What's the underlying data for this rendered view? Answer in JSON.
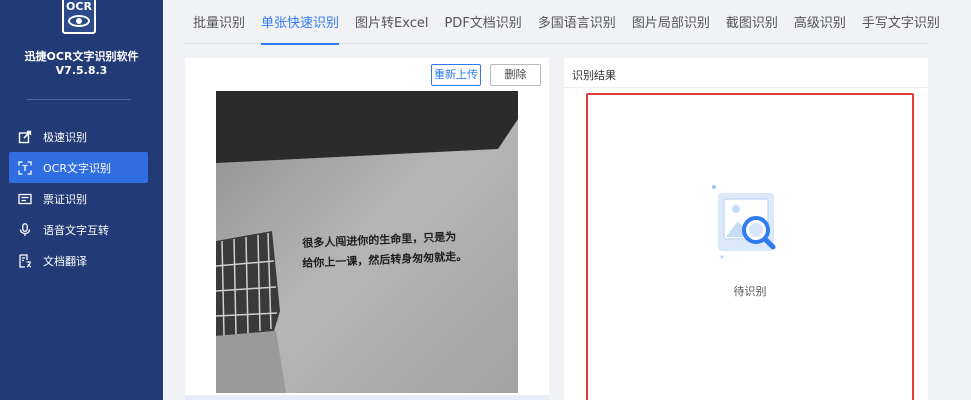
{
  "app": {
    "logo_text": "OCR",
    "name": "迅捷OCR文字识别软件",
    "version": "V7.5.8.3"
  },
  "sidebar": {
    "items": [
      {
        "label": "极速识别",
        "icon": "quick-ocr-icon",
        "active": false
      },
      {
        "label": "OCR文字识别",
        "icon": "scan-frame-icon",
        "active": true
      },
      {
        "label": "票证识别",
        "icon": "ticket-icon",
        "active": false
      },
      {
        "label": "语音文字互转",
        "icon": "microphone-icon",
        "active": false
      },
      {
        "label": "文档翻译",
        "icon": "translate-icon",
        "active": false
      }
    ]
  },
  "tabs": [
    {
      "label": "批量识别",
      "active": false
    },
    {
      "label": "单张快速识别",
      "active": true
    },
    {
      "label": "图片转Excel",
      "active": false
    },
    {
      "label": "PDF文档识别",
      "active": false
    },
    {
      "label": "多国语言识别",
      "active": false
    },
    {
      "label": "图片局部识别",
      "active": false
    },
    {
      "label": "截图识别",
      "active": false
    },
    {
      "label": "高级识别",
      "active": false
    },
    {
      "label": "手写文字识别",
      "active": false
    }
  ],
  "left_panel": {
    "reupload_label": "重新上传",
    "delete_label": "删除",
    "photo_text_line1": "很多人闯进你的生命里，只是为",
    "photo_text_line2": "给你上一课，然后转身匆匆就走。"
  },
  "right_panel": {
    "title": "识别结果",
    "pending_text": "待识别"
  },
  "colors": {
    "sidebar_bg": "#223b77",
    "accent": "#2f7bf0",
    "result_border": "#e23b3b"
  }
}
